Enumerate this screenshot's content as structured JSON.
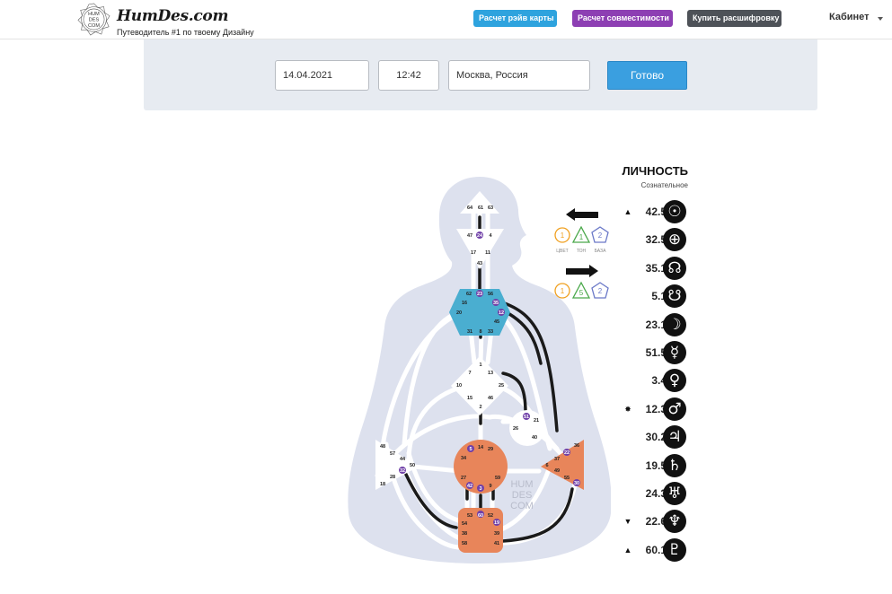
{
  "header": {
    "logo_emblem_lines": [
      "HUM",
      "DES",
      "COM"
    ],
    "logo_text": "HumDes.com",
    "tagline": "Путеводитель #1 по твоему Дизайну",
    "nav_buttons": {
      "rave": "Расчет рэйв карты",
      "compat": "Расчет совместимости",
      "buy": "Купить расшифровку"
    },
    "cabinet": "Кабинет",
    "colors": {
      "rave": "#2ea3de",
      "compat": "#8d3fb3",
      "buy": "#4e5258"
    }
  },
  "form": {
    "date": "14.04.2021",
    "time": "12:42",
    "city": "Москва, Россия",
    "submit": "Готово"
  },
  "bodygraph": {
    "watermark": [
      "HUM",
      "DES",
      "COM"
    ],
    "variables": {
      "top": {
        "color": "1",
        "tone": "1",
        "base": "2",
        "arrow": "left-arrow-icon"
      },
      "bottom": {
        "color": "1",
        "tone": "5",
        "base": "2",
        "arrow": "right-arrow-icon"
      },
      "labels": {
        "color": "ЦВЕТ",
        "tone": "ТОН",
        "base": "БАЗА"
      }
    },
    "centers": {
      "head": {
        "gates": [
          "64",
          "61",
          "63"
        ]
      },
      "ajna": {
        "gates": [
          "47",
          "24",
          "4",
          "17",
          "11",
          "43"
        ]
      },
      "throat": {
        "gates": [
          "62",
          "23",
          "56",
          "16",
          "35",
          "20",
          "12",
          "45",
          "31",
          "8",
          "33"
        ]
      },
      "g": {
        "gates": [
          "1",
          "7",
          "13",
          "10",
          "25",
          "15",
          "46",
          "2"
        ]
      },
      "ego": {
        "gates": [
          "51",
          "21",
          "26",
          "40"
        ]
      },
      "spleen": {
        "gates": [
          "48",
          "57",
          "44",
          "50",
          "32",
          "28",
          "18"
        ]
      },
      "sacral": {
        "gates": [
          "5",
          "14",
          "29",
          "34",
          "27",
          "59",
          "42",
          "3",
          "9"
        ]
      },
      "solar": {
        "gates": [
          "36",
          "22",
          "37",
          "6",
          "49",
          "55",
          "30"
        ]
      },
      "root": {
        "gates": [
          "53",
          "60",
          "52",
          "54",
          "19",
          "38",
          "39",
          "58",
          "41"
        ]
      }
    },
    "colors": {
      "defined_throat": "#4aaed0",
      "defined_orange": "#e8855a",
      "undefined": "#ffffff",
      "body": "#dfe3ef",
      "active_gate": "#7040a8"
    }
  },
  "personality": {
    "title": "ЛИЧНОСТЬ",
    "subtitle": "Сознательное",
    "rows": [
      {
        "mark": "▲",
        "value": "42.5",
        "planet": "sun-icon",
        "glyph": "☉"
      },
      {
        "mark": "",
        "value": "32.5",
        "planet": "earth-icon",
        "glyph": "⊕"
      },
      {
        "mark": "",
        "value": "35.1",
        "planet": "north-node-icon",
        "glyph": "☊"
      },
      {
        "mark": "",
        "value": "5.1",
        "planet": "south-node-icon",
        "glyph": "☋"
      },
      {
        "mark": "",
        "value": "23.1",
        "planet": "moon-icon",
        "glyph": "☽"
      },
      {
        "mark": "",
        "value": "51.5",
        "planet": "mercury-icon",
        "glyph": "☿"
      },
      {
        "mark": "",
        "value": "3.4",
        "planet": "venus-icon",
        "glyph": "♀"
      },
      {
        "mark": "✸",
        "value": "12.3",
        "planet": "mars-icon",
        "glyph": "♂"
      },
      {
        "mark": "",
        "value": "30.2",
        "planet": "jupiter-icon",
        "glyph": "♃"
      },
      {
        "mark": "",
        "value": "19.5",
        "planet": "saturn-icon",
        "glyph": "♄"
      },
      {
        "mark": "",
        "value": "24.3",
        "planet": "uranus-icon",
        "glyph": "♅"
      },
      {
        "mark": "▼",
        "value": "22.6",
        "planet": "neptune-icon",
        "glyph": "♆"
      },
      {
        "mark": "▲",
        "value": "60.1",
        "planet": "pluto-icon",
        "glyph": "♇"
      }
    ]
  }
}
